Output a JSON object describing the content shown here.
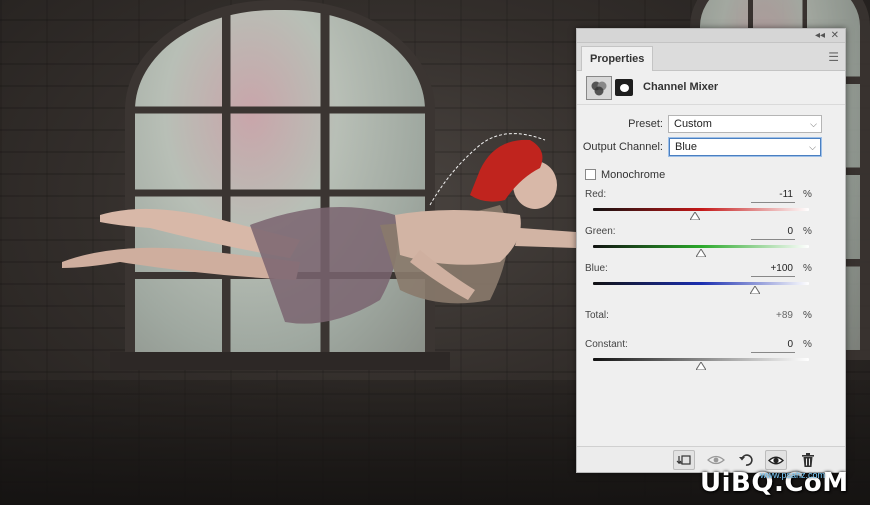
{
  "panel": {
    "tab_label": "Properties",
    "title": "Channel Mixer",
    "adjustment_icon": "channel-mixer-icon",
    "mask_icon": "layer-mask-icon",
    "preset_label": "Preset:",
    "preset_value": "Custom",
    "output_channel_label": "Output Channel:",
    "output_channel_value": "Blue",
    "monochrome_label": "Monochrome",
    "monochrome_checked": false,
    "sliders": [
      {
        "label": "Red:",
        "value": "-11",
        "unit": "%",
        "fraction": 0.472,
        "color": "#c41818"
      },
      {
        "label": "Green:",
        "value": "0",
        "unit": "%",
        "fraction": 0.5,
        "color": "#2aa82a"
      },
      {
        "label": "Blue:",
        "value": "+100",
        "unit": "%",
        "fraction": 0.75,
        "color": "#1a2eb0"
      }
    ],
    "total_label": "Total:",
    "total_value": "+89",
    "total_unit": "%",
    "constant": {
      "label": "Constant:",
      "value": "0",
      "unit": "%",
      "fraction": 0.5
    },
    "bottom_buttons": [
      {
        "name": "clip-to-layer-icon",
        "active": true
      },
      {
        "name": "view-previous-state-icon",
        "active": false
      },
      {
        "name": "reset-icon",
        "active": false
      },
      {
        "name": "toggle-visibility-icon",
        "active": true
      },
      {
        "name": "delete-icon",
        "active": false
      }
    ]
  },
  "watermark": {
    "text": "UiBQ.CoM",
    "subtext": "www.psahz.com"
  }
}
